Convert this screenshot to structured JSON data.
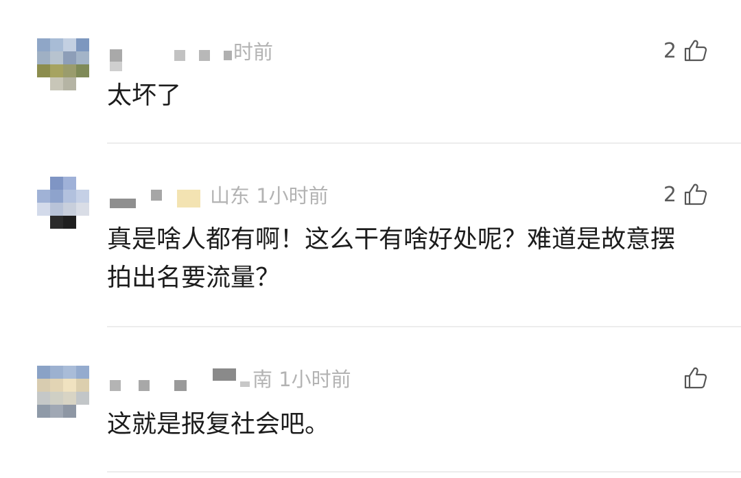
{
  "comments": [
    {
      "meta_suffix": "时前",
      "text": "太坏了",
      "likes": "2",
      "like_icon": "thumbs-up-icon"
    },
    {
      "meta_suffix": "山东 1小时前",
      "text": "真是啥人都有啊！这么干有啥好处呢？难道是故意摆拍出名要流量？",
      "likes": "2",
      "like_icon": "thumbs-up-icon"
    },
    {
      "meta_suffix": "南 1小时前",
      "text": "这就是报复社会吧。",
      "likes": "",
      "like_icon": "thumbs-up-icon"
    }
  ],
  "colors": {
    "meta_text": "#b3b3b3",
    "body_text": "#1c1c1c",
    "divider": "#ececec"
  }
}
